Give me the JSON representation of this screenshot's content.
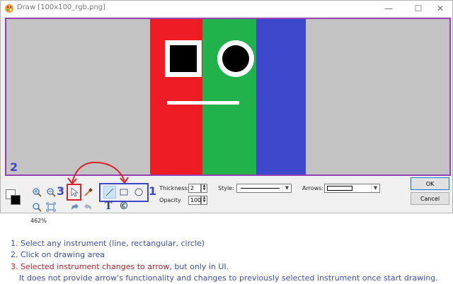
{
  "window": {
    "title": "Draw [100x100_rgb.png]",
    "icon": "paint-palette-icon",
    "controls": {
      "minimize": "—",
      "maximize": "☐",
      "close": "✕"
    }
  },
  "canvas": {
    "callout_number": "2",
    "image_colors": {
      "red": "#ee1c25",
      "green": "#22b24c",
      "blue": "#3e48cc",
      "background": "#c3c3c3"
    }
  },
  "toolbar": {
    "zoom_level": "462%",
    "callout_select_number": "3",
    "callout_instruments_number": "1",
    "icons": {
      "zoom_in": "zoom-in-icon",
      "zoom_out": "zoom-out-icon",
      "zoom_actual": "zoom-actual-icon",
      "zoom_fit": "zoom-fit-icon",
      "cursor": "cursor-arrow-icon",
      "eyedropper": "eyedropper-icon",
      "undo": "undo-icon",
      "redo": "redo-icon",
      "line": "line-tool-icon",
      "rectangle": "rectangle-tool-icon",
      "circle": "circle-tool-icon"
    },
    "text_tool_glyph": "T",
    "copyright_tool_glyph": "©",
    "thickness_label": "Thickness:",
    "thickness_value": "2",
    "opacity_label": "Opacity",
    "opacity_value": "100",
    "style_label": "Style:",
    "arrows_label": "Arrows:",
    "ok_label": "OK",
    "cancel_label": "Cancel"
  },
  "notes": {
    "line1": "1. Select any instrument (line, rectangular, circle)",
    "line2": "2. Click on drawing area",
    "line3_red": "3. Selected instrument changes to arrow,",
    "line3_blue": " but only in UI.",
    "line4": "It does not provide arrow's functionality and changes to previously selected instrument once start drawing."
  }
}
